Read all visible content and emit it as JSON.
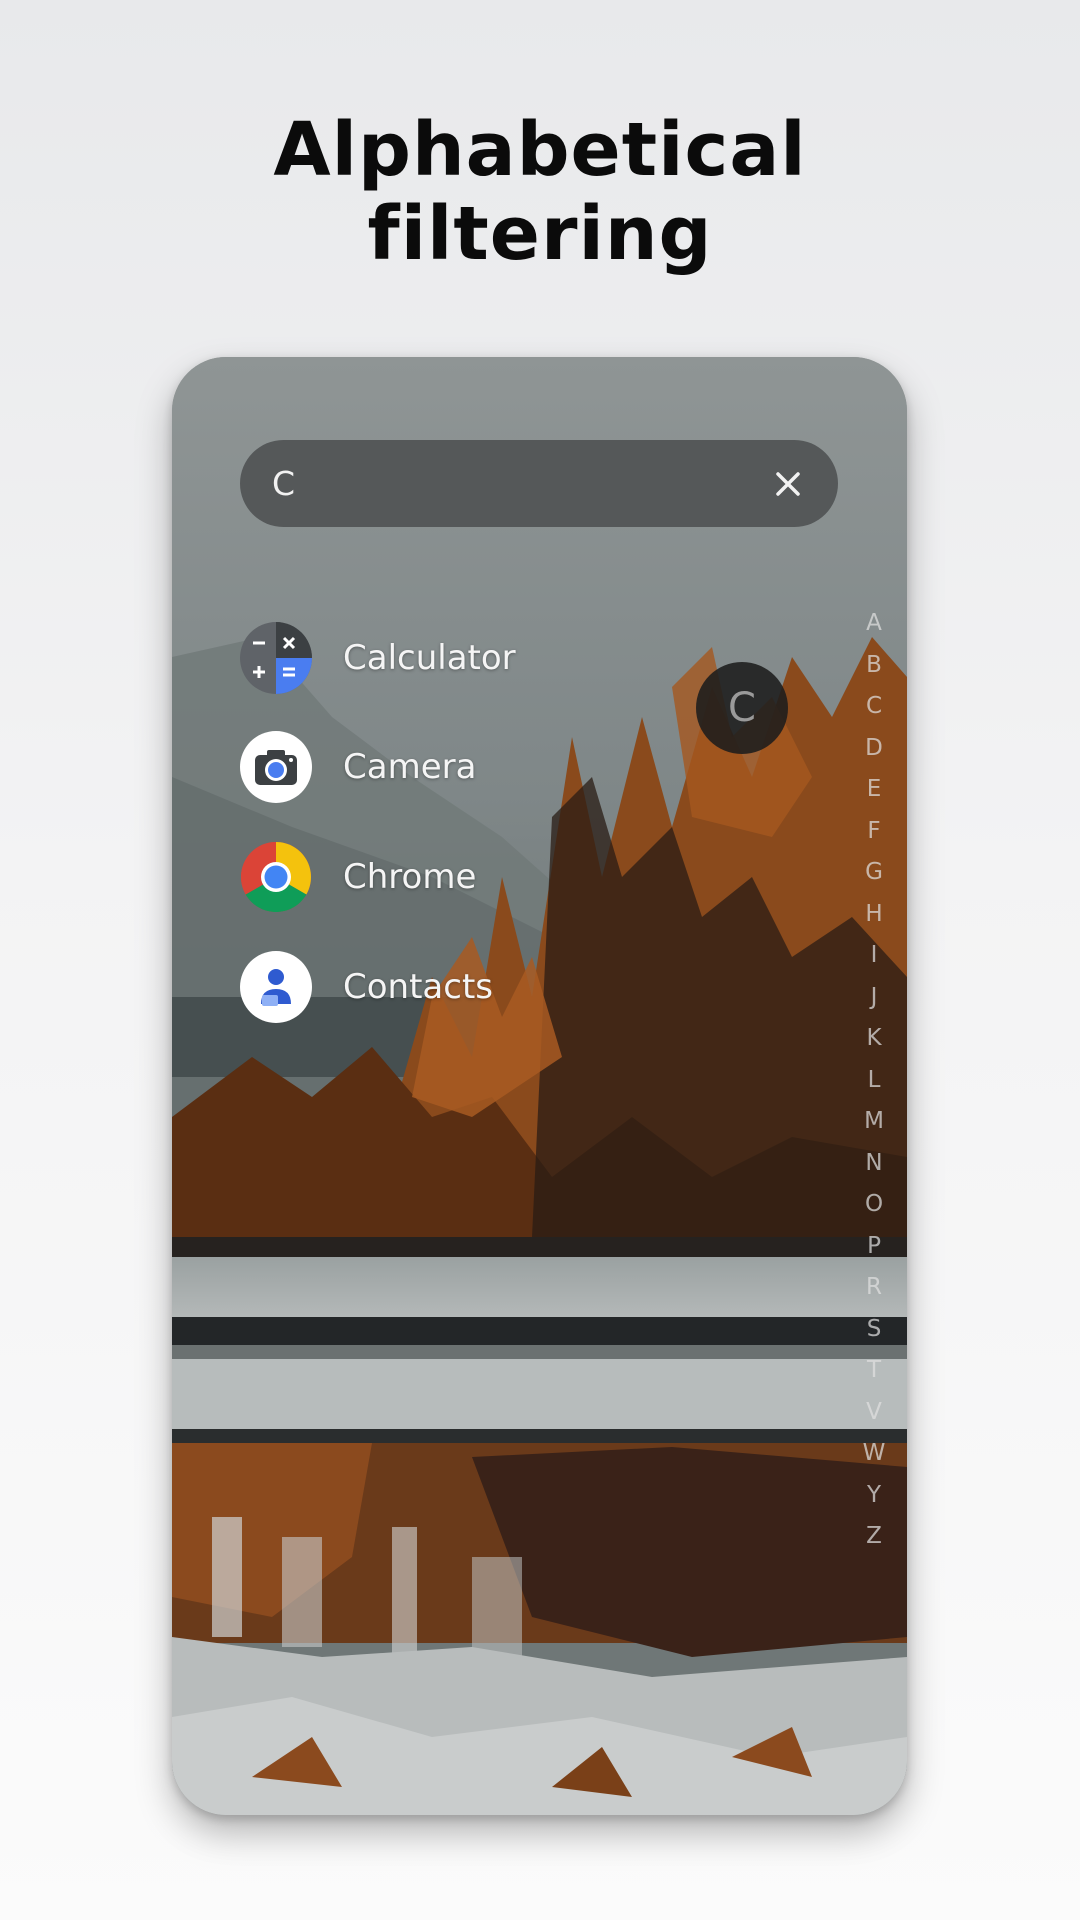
{
  "headline": {
    "line1": "Alphabetical",
    "line2": "filtering"
  },
  "search": {
    "query": "C",
    "clear_icon": "close-icon"
  },
  "apps": [
    {
      "label": "Calculator",
      "icon": "calculator-icon"
    },
    {
      "label": "Camera",
      "icon": "camera-icon"
    },
    {
      "label": "Chrome",
      "icon": "chrome-icon"
    },
    {
      "label": "Contacts",
      "icon": "contacts-icon"
    }
  ],
  "index_letters": [
    "A",
    "B",
    "C",
    "D",
    "E",
    "F",
    "G",
    "H",
    "I",
    "J",
    "K",
    "L",
    "M",
    "N",
    "O",
    "P",
    "R",
    "S",
    "T",
    "V",
    "W",
    "Y",
    "Z"
  ],
  "active_letter": "C",
  "colors": {
    "search_bar": "#555859",
    "bubble": "#1c1c1c",
    "foliage": "#8a4a1c",
    "calculator_accent": "#4a7df0",
    "chrome_red": "#db4437",
    "chrome_yellow": "#f4c20d",
    "chrome_green": "#0f9d58",
    "chrome_blue": "#4285f4"
  }
}
